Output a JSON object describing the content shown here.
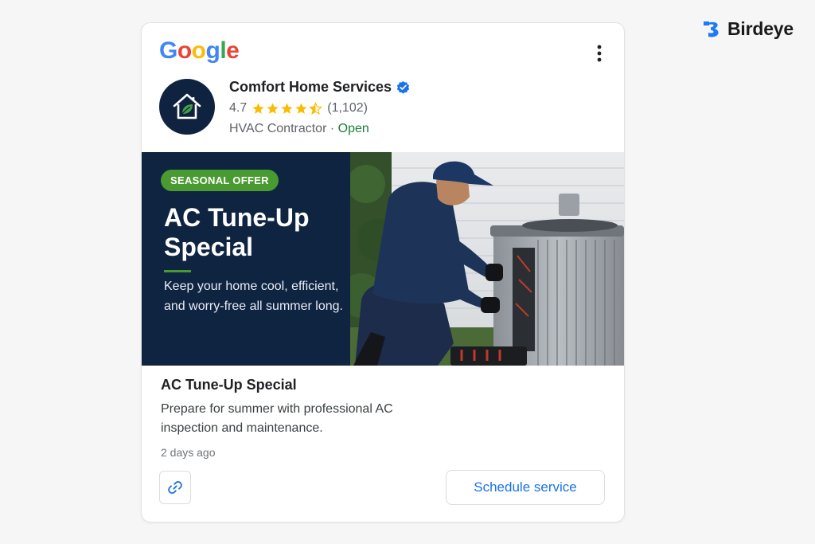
{
  "brand": {
    "name": "Birdeye",
    "color": "#1f7af5",
    "icon": "birdeye-logo-icon"
  },
  "google": {
    "letters": [
      {
        "ch": "G",
        "color": "#4285F4"
      },
      {
        "ch": "o",
        "color": "#EA4335"
      },
      {
        "ch": "o",
        "color": "#FBBC05"
      },
      {
        "ch": "g",
        "color": "#4285F4"
      },
      {
        "ch": "l",
        "color": "#34A853"
      },
      {
        "ch": "e",
        "color": "#EA4335"
      }
    ]
  },
  "business": {
    "name": "Comfort Home Services",
    "verified_icon": "verified-check-icon",
    "rating": "4.7",
    "rating_value": 4.7,
    "rating_max": 5,
    "review_count": "(1,102)",
    "category": "HVAC Contractor",
    "separator": " · ",
    "status": "Open",
    "avatar_icon": "house-leaf-icon"
  },
  "hero": {
    "badge": "SEASONAL OFFER",
    "title": "AC Tune-Up Special",
    "subtitle": "Keep your home cool, efficient, and worry-free all summer long.",
    "accent": "#4a9a32",
    "panel_color": "#0f2441"
  },
  "post": {
    "title": "AC Tune-Up Special",
    "body": "Prepare for summer with professional AC inspection and maintenance.",
    "time": "2 days ago"
  },
  "actions": {
    "link_icon": "link-icon",
    "cta_label": "Schedule service",
    "cta_color": "#1a73e8"
  },
  "menu_icon": "more-vert-icon"
}
